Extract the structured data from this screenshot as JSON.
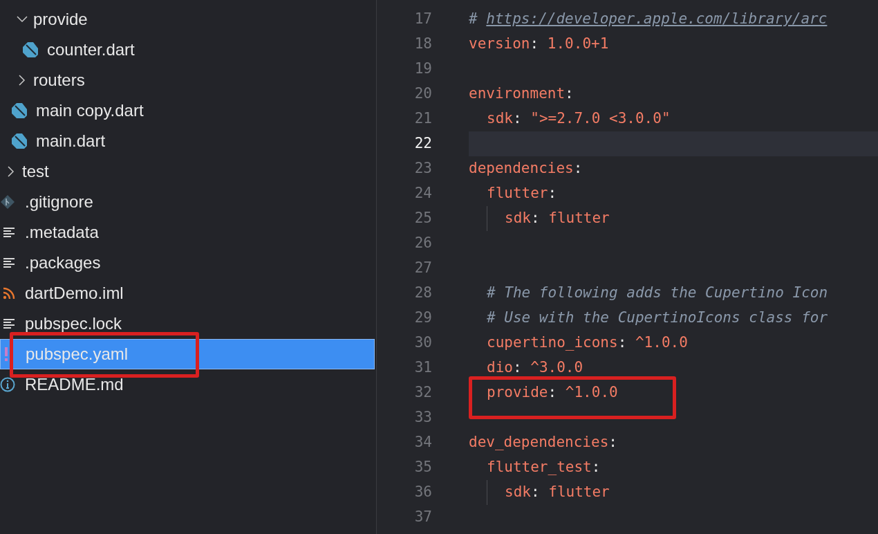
{
  "explorer": {
    "nested_items": [
      {
        "kind": "folder",
        "label": "provide",
        "expanded": true,
        "selected": false,
        "children": [
          {
            "kind": "dart",
            "label": "counter.dart",
            "selected": false
          }
        ]
      },
      {
        "kind": "folder",
        "label": "routers",
        "expanded": false,
        "selected": false
      },
      {
        "kind": "dart",
        "label": "main copy.dart",
        "selected": false
      },
      {
        "kind": "dart",
        "label": "main.dart",
        "selected": false
      }
    ],
    "items": [
      {
        "kind": "folder",
        "label": "test",
        "expanded": false,
        "selected": false
      },
      {
        "kind": "git",
        "label": ".gitignore",
        "selected": false
      },
      {
        "kind": "text",
        "label": ".metadata",
        "selected": false
      },
      {
        "kind": "text",
        "label": ".packages",
        "selected": false
      },
      {
        "kind": "feed",
        "label": "dartDemo.iml",
        "selected": false
      },
      {
        "kind": "text",
        "label": "pubspec.lock",
        "selected": false
      },
      {
        "kind": "yaml",
        "label": "pubspec.yaml",
        "selected": true
      },
      {
        "kind": "info",
        "label": "README.md",
        "selected": false
      }
    ]
  },
  "editor": {
    "lines": [
      {
        "number": "17",
        "current": false,
        "tokens": [
          {
            "kind": "comment",
            "text": "# "
          },
          {
            "kind": "link",
            "text": "https://developer.apple.com/library/arc"
          }
        ]
      },
      {
        "number": "18",
        "current": false,
        "tokens": [
          {
            "kind": "key",
            "text": "version"
          },
          {
            "kind": "punct",
            "text": ": "
          },
          {
            "kind": "value",
            "text": "1.0.0+1"
          }
        ]
      },
      {
        "number": "19",
        "current": false
      },
      {
        "number": "20",
        "current": false,
        "tokens": [
          {
            "kind": "key",
            "text": "environment"
          },
          {
            "kind": "punct",
            "text": ":"
          }
        ]
      },
      {
        "number": "21",
        "current": false,
        "indented": true,
        "tokens": [
          {
            "kind": "key",
            "text": "sdk"
          },
          {
            "kind": "punct",
            "text": ": "
          },
          {
            "kind": "value",
            "text": "\">=2.7.0 <3.0.0\""
          }
        ]
      },
      {
        "number": "22",
        "current": true
      },
      {
        "number": "23",
        "current": false,
        "tokens": [
          {
            "kind": "key",
            "text": "dependencies"
          },
          {
            "kind": "punct",
            "text": ":"
          }
        ]
      },
      {
        "number": "24",
        "current": false,
        "indented": true,
        "tokens": [
          {
            "kind": "key",
            "text": "flutter"
          },
          {
            "kind": "punct",
            "text": ":"
          }
        ]
      },
      {
        "number": "25",
        "current": false,
        "indented": true,
        "guide": true,
        "tokens": [
          {
            "kind": "key",
            "text": "sdk"
          },
          {
            "kind": "punct",
            "text": ": "
          },
          {
            "kind": "value",
            "text": "flutter"
          }
        ]
      },
      {
        "number": "26",
        "current": false
      },
      {
        "number": "27",
        "current": false
      },
      {
        "number": "28",
        "current": false,
        "indented": true,
        "tokens": [
          {
            "kind": "comment",
            "text": "# The following adds the Cupertino Icon"
          }
        ]
      },
      {
        "number": "29",
        "current": false,
        "indented": true,
        "tokens": [
          {
            "kind": "comment",
            "text": "# Use with the CupertinoIcons class for"
          }
        ]
      },
      {
        "number": "30",
        "current": false,
        "indented": true,
        "tokens": [
          {
            "kind": "key",
            "text": "cupertino_icons"
          },
          {
            "kind": "punct",
            "text": ": "
          },
          {
            "kind": "value",
            "text": "^1.0.0"
          }
        ]
      },
      {
        "number": "31",
        "current": false,
        "indented": true,
        "tokens": [
          {
            "kind": "key",
            "text": "dio"
          },
          {
            "kind": "punct",
            "text": ": "
          },
          {
            "kind": "value",
            "text": "^3.0.0"
          }
        ]
      },
      {
        "number": "32",
        "current": false,
        "indented": true,
        "tokens": [
          {
            "kind": "key",
            "text": "provide"
          },
          {
            "kind": "punct",
            "text": ": "
          },
          {
            "kind": "value",
            "text": "^1.0.0"
          }
        ]
      },
      {
        "number": "33",
        "current": false
      },
      {
        "number": "34",
        "current": false,
        "tokens": [
          {
            "kind": "key",
            "text": "dev_dependencies"
          },
          {
            "kind": "punct",
            "text": ":"
          }
        ]
      },
      {
        "number": "35",
        "current": false,
        "indented": true,
        "tokens": [
          {
            "kind": "key",
            "text": "flutter_test"
          },
          {
            "kind": "punct",
            "text": ":"
          }
        ]
      },
      {
        "number": "36",
        "current": false,
        "indented": true,
        "guide": true,
        "tokens": [
          {
            "kind": "key",
            "text": "sdk"
          },
          {
            "kind": "punct",
            "text": ": "
          },
          {
            "kind": "value",
            "text": "flutter"
          }
        ]
      },
      {
        "number": "37",
        "current": false
      }
    ]
  }
}
